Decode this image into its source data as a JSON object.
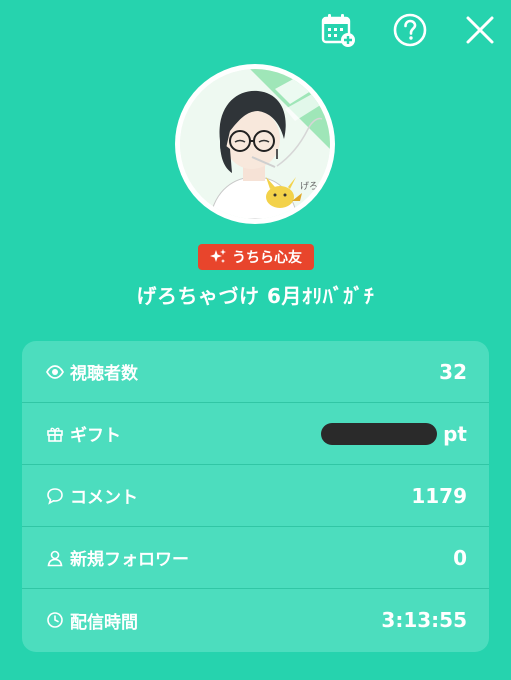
{
  "badge": {
    "label": "うちら心友"
  },
  "stream": {
    "title": "げろちゃづけ 6月ｵﾘﾊﾞｶﾞﾁ"
  },
  "stats": [
    {
      "label": "視聴者数",
      "value": "32",
      "icon": "eye-icon"
    },
    {
      "label": "ギフト",
      "value": "",
      "unit": "pt",
      "icon": "gift-icon",
      "redacted": true
    },
    {
      "label": "コメント",
      "value": "1179",
      "icon": "comment-icon"
    },
    {
      "label": "新規フォロワー",
      "value": "0",
      "icon": "person-icon"
    },
    {
      "label": "配信時間",
      "value": "3:13:55",
      "icon": "clock-icon"
    }
  ],
  "colors": {
    "background": "#26D3AE",
    "card": "#4CDDBE",
    "badge": "#E8452C",
    "redaction": "#2a2a2a"
  }
}
